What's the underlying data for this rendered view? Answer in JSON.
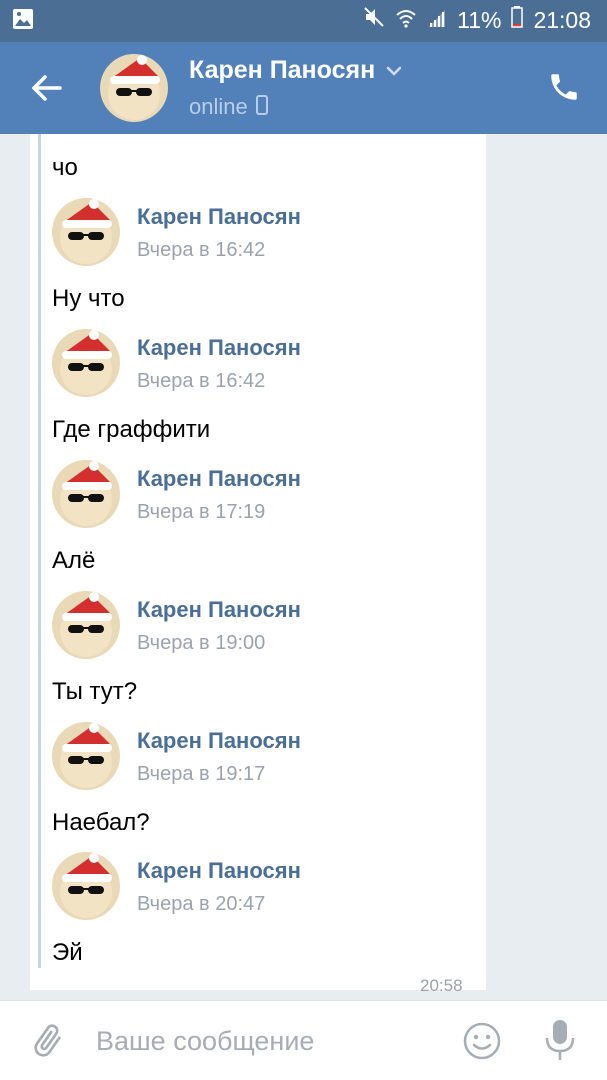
{
  "status_bar": {
    "battery": "11%",
    "time": "21:08",
    "icons": [
      "gallery-icon",
      "mute-icon",
      "wifi-icon",
      "signal-icon",
      "battery-icon"
    ]
  },
  "header": {
    "name": "Карен Паносян",
    "status": "online",
    "icons": [
      "back-arrow-icon",
      "chevron-down-icon",
      "phone-device-icon",
      "phone-call-icon"
    ]
  },
  "messages": [
    {
      "text": "чо"
    },
    {
      "forwarded_from": "Карен Паносян",
      "time": "Вчера в 16:42",
      "text": "Ну что"
    },
    {
      "forwarded_from": "Карен Паносян",
      "time": "Вчера в 16:42",
      "text": "Где граффити"
    },
    {
      "forwarded_from": "Карен Паносян",
      "time": "Вчера в 17:19",
      "text": "Алё"
    },
    {
      "forwarded_from": "Карен Паносян",
      "time": "Вчера в 19:00",
      "text": "Ты тут?"
    },
    {
      "forwarded_from": "Карен Паносян",
      "time": "Вчера в 19:17",
      "text": "Наебал?"
    },
    {
      "forwarded_from": "Карен Паносян",
      "time": "Вчера в 20:47",
      "text": "Эй"
    }
  ],
  "message_time": "20:58",
  "input": {
    "placeholder": "Ваше сообщение",
    "value": ""
  },
  "colors": {
    "header_bg": "#5281b9",
    "status_bar_bg": "#4a6e94",
    "name_color": "#4a6e94",
    "chat_bg": "#e8edf2"
  }
}
